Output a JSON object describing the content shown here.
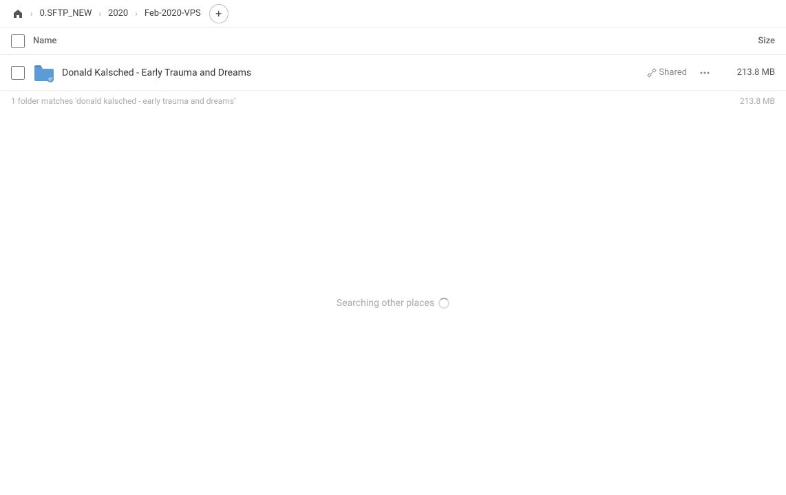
{
  "breadcrumb": {
    "home_icon": "🏠",
    "items": [
      {
        "label": "0.SFTP_NEW"
      },
      {
        "label": "2020"
      },
      {
        "label": "Feb-2020-VPS"
      }
    ],
    "add_label": "+"
  },
  "table": {
    "header": {
      "name_label": "Name",
      "size_label": "Size"
    }
  },
  "file_row": {
    "name": "Donald Kalsched - Early Trauma and Dreams",
    "shared_label": "Shared",
    "size": "213.8 MB"
  },
  "status": {
    "text": "1 folder matches 'donald kalsched - early trauma and dreams'",
    "size": "213.8 MB"
  },
  "loading": {
    "text": "Searching other places"
  }
}
